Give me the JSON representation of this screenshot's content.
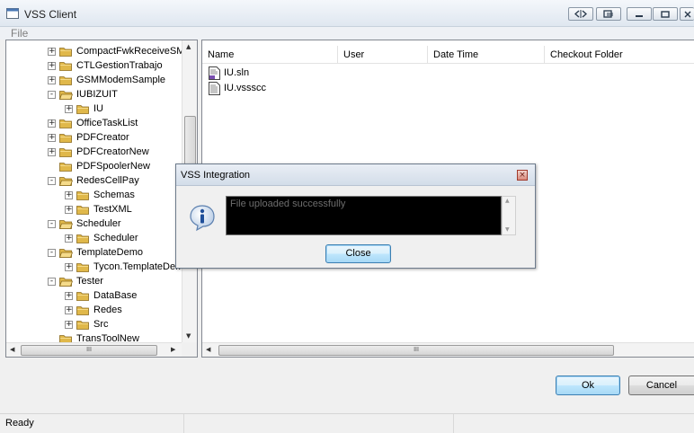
{
  "window": {
    "title": "VSS Client",
    "controls": [
      "switch-icon",
      "copy-window-icon",
      "minimize-icon",
      "restore-icon",
      "close-icon"
    ]
  },
  "menu": {
    "file": "File"
  },
  "tree": {
    "items": [
      {
        "label": "CompactFwkReceiveSMS",
        "level": 0,
        "expander": "+",
        "open": false
      },
      {
        "label": "CTLGestionTrabajo",
        "level": 0,
        "expander": "+",
        "open": false
      },
      {
        "label": "GSMModemSample",
        "level": 0,
        "expander": "+",
        "open": false
      },
      {
        "label": "IUBIZUIT",
        "level": 0,
        "expander": "-",
        "open": true
      },
      {
        "label": "IU",
        "level": 1,
        "expander": "+",
        "open": false
      },
      {
        "label": "OfficeTaskList",
        "level": 0,
        "expander": "+",
        "open": false
      },
      {
        "label": "PDFCreator",
        "level": 0,
        "expander": "+",
        "open": false
      },
      {
        "label": "PDFCreatorNew",
        "level": 0,
        "expander": "+",
        "open": false
      },
      {
        "label": "PDFSpoolerNew",
        "level": 0,
        "expander": "",
        "open": false
      },
      {
        "label": "RedesCellPay",
        "level": 0,
        "expander": "-",
        "open": true
      },
      {
        "label": "Schemas",
        "level": 1,
        "expander": "+",
        "open": false
      },
      {
        "label": "TestXML",
        "level": 1,
        "expander": "+",
        "open": false
      },
      {
        "label": "Scheduler",
        "level": 0,
        "expander": "-",
        "open": true
      },
      {
        "label": "Scheduler",
        "level": 1,
        "expander": "+",
        "open": false
      },
      {
        "label": "TemplateDemo",
        "level": 0,
        "expander": "-",
        "open": true
      },
      {
        "label": "Tycon.TemplateDemo",
        "level": 1,
        "expander": "+",
        "open": false
      },
      {
        "label": "Tester",
        "level": 0,
        "expander": "-",
        "open": true
      },
      {
        "label": "DataBase",
        "level": 1,
        "expander": "+",
        "open": false
      },
      {
        "label": "Redes",
        "level": 1,
        "expander": "+",
        "open": false
      },
      {
        "label": "Src",
        "level": 1,
        "expander": "+",
        "open": false
      },
      {
        "label": "TransToolNew",
        "level": 0,
        "expander": "",
        "open": false
      }
    ],
    "hscroll_grip": "III"
  },
  "list": {
    "columns": [
      "Name",
      "User",
      "Date Time",
      "Checkout Folder"
    ],
    "files": [
      {
        "name": "IU.sln"
      },
      {
        "name": "IU.vssscc"
      }
    ],
    "hscroll_grip": "III"
  },
  "buttons": {
    "ok": "Ok",
    "cancel": "Cancel"
  },
  "status": {
    "text": "Ready"
  },
  "dialog": {
    "title": "VSS Integration",
    "message": "File uploaded successfully",
    "close_button": "Close",
    "close_glyph": "×",
    "icon": "info-icon"
  },
  "colors": {
    "folder": "#e0b84a",
    "selection_accent": "#3c7fb1",
    "message_bg": "#000000",
    "message_text": "#6d6d6d"
  }
}
